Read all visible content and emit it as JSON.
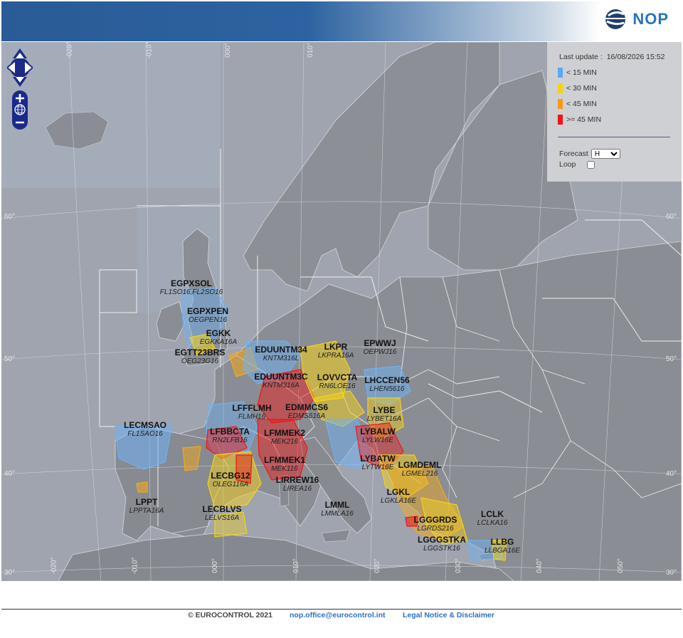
{
  "header": {
    "logo_text": "NOP"
  },
  "legend": {
    "last_update_label": "Last update :",
    "last_update_value": "16/08/2026 15:52",
    "items": [
      {
        "label": "< 15 MIN",
        "color": "#5aa9f5"
      },
      {
        "label": "< 30 MIN",
        "color": "#f5d21a"
      },
      {
        "label": "< 45 MIN",
        "color": "#f59a1a"
      },
      {
        "label": ">= 45 MIN",
        "color": "#f01414"
      }
    ],
    "forecast_label": "Forecast",
    "forecast_value": "H",
    "loop_label": "Loop"
  },
  "grid_labels": {
    "lon": [
      "-020°",
      "-010°",
      "000°",
      "010°",
      "020°",
      "030°",
      "040°",
      "050°"
    ],
    "lat": [
      "60°",
      "50°",
      "40°",
      "30°"
    ]
  },
  "regulations": [
    {
      "code": "EGPXSOL",
      "sub": "FL1SO16,FL2SO16"
    },
    {
      "code": "EGPXPEN",
      "sub": "OEGPEN16"
    },
    {
      "code": "EGKK",
      "sub": "EGKKA16A"
    },
    {
      "code": "EGTT23BRS",
      "sub": "OEG23G16"
    },
    {
      "code": "EDUUNTM34",
      "sub": "KNTM316L"
    },
    {
      "code": "LKPR",
      "sub": "LKPRA16A"
    },
    {
      "code": "EPWWJ",
      "sub": "OEPWJ16"
    },
    {
      "code": "EDUUNTM3C",
      "sub": "KNTM316A"
    },
    {
      "code": "LOVVCTA",
      "sub": "RN6LOE16"
    },
    {
      "code": "LHCCEN56",
      "sub": "LHEN5616"
    },
    {
      "code": "LFFFLMH",
      "sub": "FLMH16"
    },
    {
      "code": "EDMMCS6",
      "sub": "EDMS616A"
    },
    {
      "code": "LYBE",
      "sub": "LYBET16A"
    },
    {
      "code": "LECMSAO",
      "sub": "FL1SAO16"
    },
    {
      "code": "LFBBCTA",
      "sub": "RN2LFB16"
    },
    {
      "code": "LFMMEK2",
      "sub": "MEK216"
    },
    {
      "code": "LYBALW",
      "sub": "LYLW16E"
    },
    {
      "code": "LFMMEK1",
      "sub": "MEK116"
    },
    {
      "code": "LYBATW",
      "sub": "LYTW16E"
    },
    {
      "code": "LGMDEML",
      "sub": "LGMEL216"
    },
    {
      "code": "LECBG12",
      "sub": "OLEG116A"
    },
    {
      "code": "LIRREW16",
      "sub": "LIREA16"
    },
    {
      "code": "LPPT",
      "sub": "LPPTA16A"
    },
    {
      "code": "LGKL",
      "sub": "LGKLA16E"
    },
    {
      "code": "LMML",
      "sub": "LMMLA16"
    },
    {
      "code": "LECBLVS",
      "sub": "LELVS16A"
    },
    {
      "code": "LCLK",
      "sub": "LCLKA16"
    },
    {
      "code": "LGGGRDS",
      "sub": "LGRDS216"
    },
    {
      "code": "LLBG",
      "sub": "LLBGA16E"
    },
    {
      "code": "LGGGSTKA",
      "sub": "LGGSTK16"
    }
  ],
  "footer": {
    "copyright": "© EUROCONTROL 2021",
    "email": "nop.office@eurocontrol.int",
    "legal": "Legal Notice & Disclaimer"
  }
}
